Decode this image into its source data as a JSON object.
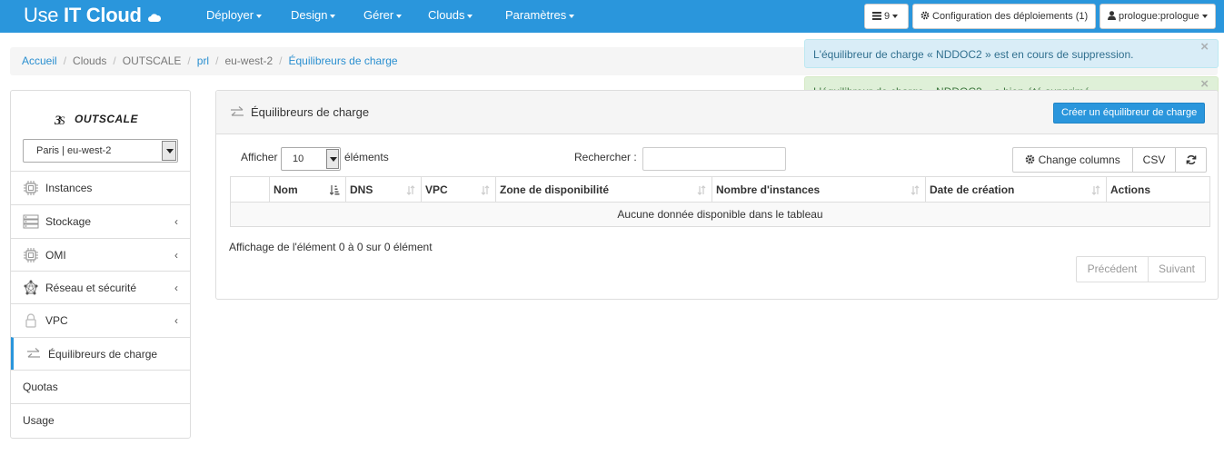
{
  "brand": {
    "light": "Use ",
    "bold": "IT Cloud"
  },
  "nav": {
    "items": [
      "Déployer",
      "Design",
      "Gérer",
      "Clouds",
      "Paramètres"
    ],
    "tasks_count": "9",
    "deployments_label": "Configuration des déploiements (1)",
    "user_label": "prologue:prologue"
  },
  "breadcrumb": [
    "Accueil",
    "Clouds",
    "OUTSCALE",
    "prl",
    "eu-west-2",
    "Équilibreurs de charge"
  ],
  "alerts": {
    "info": "L'équilibreur de charge « NDDOC2 » est en cours de suppression.",
    "success": "L'équilibreur de charge « NDDOC2 » a bien été supprimé",
    "close_symbol": "×"
  },
  "sidebar": {
    "provider_logo_text": "OUTSCALE",
    "region": "Paris | eu-west-2",
    "items": [
      {
        "label": "Instances"
      },
      {
        "label": "Stockage"
      },
      {
        "label": "OMI"
      },
      {
        "label": "Réseau et sécurité"
      },
      {
        "label": "VPC"
      },
      {
        "label": "Équilibreurs de charge"
      },
      {
        "label": "Quotas"
      },
      {
        "label": "Usage"
      }
    ],
    "chevron": "‹"
  },
  "panel": {
    "title": "Équilibreurs de charge",
    "create_button": "Créer un équilibreur de charge",
    "show_label": "Afficher",
    "page_length": "10",
    "entries_label": "éléments",
    "search_label": "Rechercher :",
    "search_value": "",
    "change_columns": "Change columns",
    "csv": "CSV",
    "columns": [
      "",
      "Nom",
      "DNS",
      "VPC",
      "Zone de disponibilité",
      "Nombre d'instances",
      "Date de création",
      "Actions"
    ],
    "empty_message": "Aucune donnée disponible dans le tableau",
    "info": "Affichage de l'élément 0 à 0 sur 0 élément",
    "prev": "Précédent",
    "next": "Suivant"
  },
  "colors": {
    "navbar": "#2a96dc",
    "link": "#2a8fd0",
    "info_bg": "#d9edf7",
    "success_bg": "#dff0d8"
  }
}
